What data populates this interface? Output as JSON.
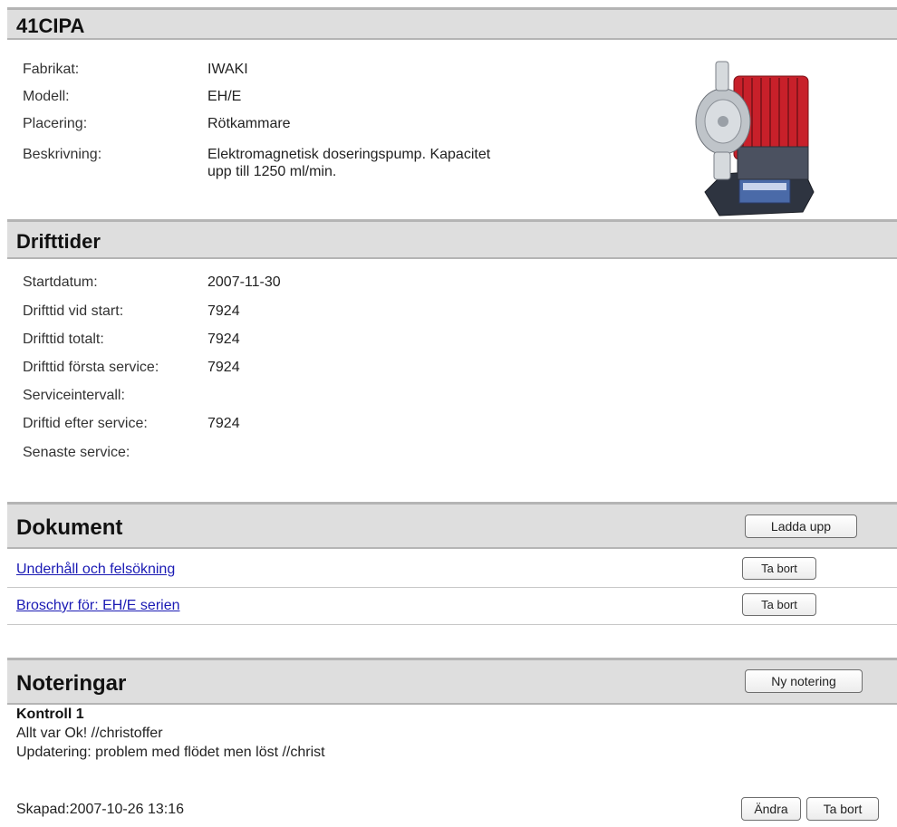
{
  "device": {
    "title": "41CIPA",
    "fields": [
      {
        "label": "Fabrikat:",
        "value": "IWAKI"
      },
      {
        "label": "Modell:",
        "value": "EH/E"
      },
      {
        "label": "Placering:",
        "value": "Rötkammare"
      },
      {
        "label": "Beskrivning:",
        "value_line1": "Elektromagnetisk doseringspump. Kapacitet",
        "value_line2": "upp till 1250 ml/min."
      }
    ]
  },
  "drifttider": {
    "title": "Drifttider",
    "fields": [
      {
        "label": "Startdatum:",
        "value": "2007-11-30"
      },
      {
        "label": "Drifttid vid start:",
        "value": "7924"
      },
      {
        "label": "Drifttid totalt:",
        "value": "7924"
      },
      {
        "label": "Drifttid första service:",
        "value": "7924"
      },
      {
        "label": "Serviceintervall:",
        "value": ""
      },
      {
        "label": "Driftid efter service:",
        "value": "7924"
      },
      {
        "label": "Senaste service:",
        "value": ""
      }
    ]
  },
  "dokument": {
    "title": "Dokument",
    "upload_label": "Ladda upp",
    "items": [
      {
        "name": "Underhåll och felsökning",
        "remove_label": "Ta bort"
      },
      {
        "name": "Broschyr för: EH/E serien",
        "remove_label": "Ta bort"
      }
    ]
  },
  "noteringar": {
    "title": "Noteringar",
    "new_label": "Ny notering",
    "note": {
      "heading": "Kontroll 1",
      "line1": "Allt var Ok! //christoffer",
      "line2": "Updatering: problem med flödet men löst //christ",
      "created": "Skapad:2007-10-26 13:16",
      "edit_label": "Ändra",
      "remove_label": "Ta bort"
    }
  },
  "colors": {
    "link": "#1a1ab4",
    "header_bg": "#dedede",
    "pump_red": "#c8202a"
  }
}
